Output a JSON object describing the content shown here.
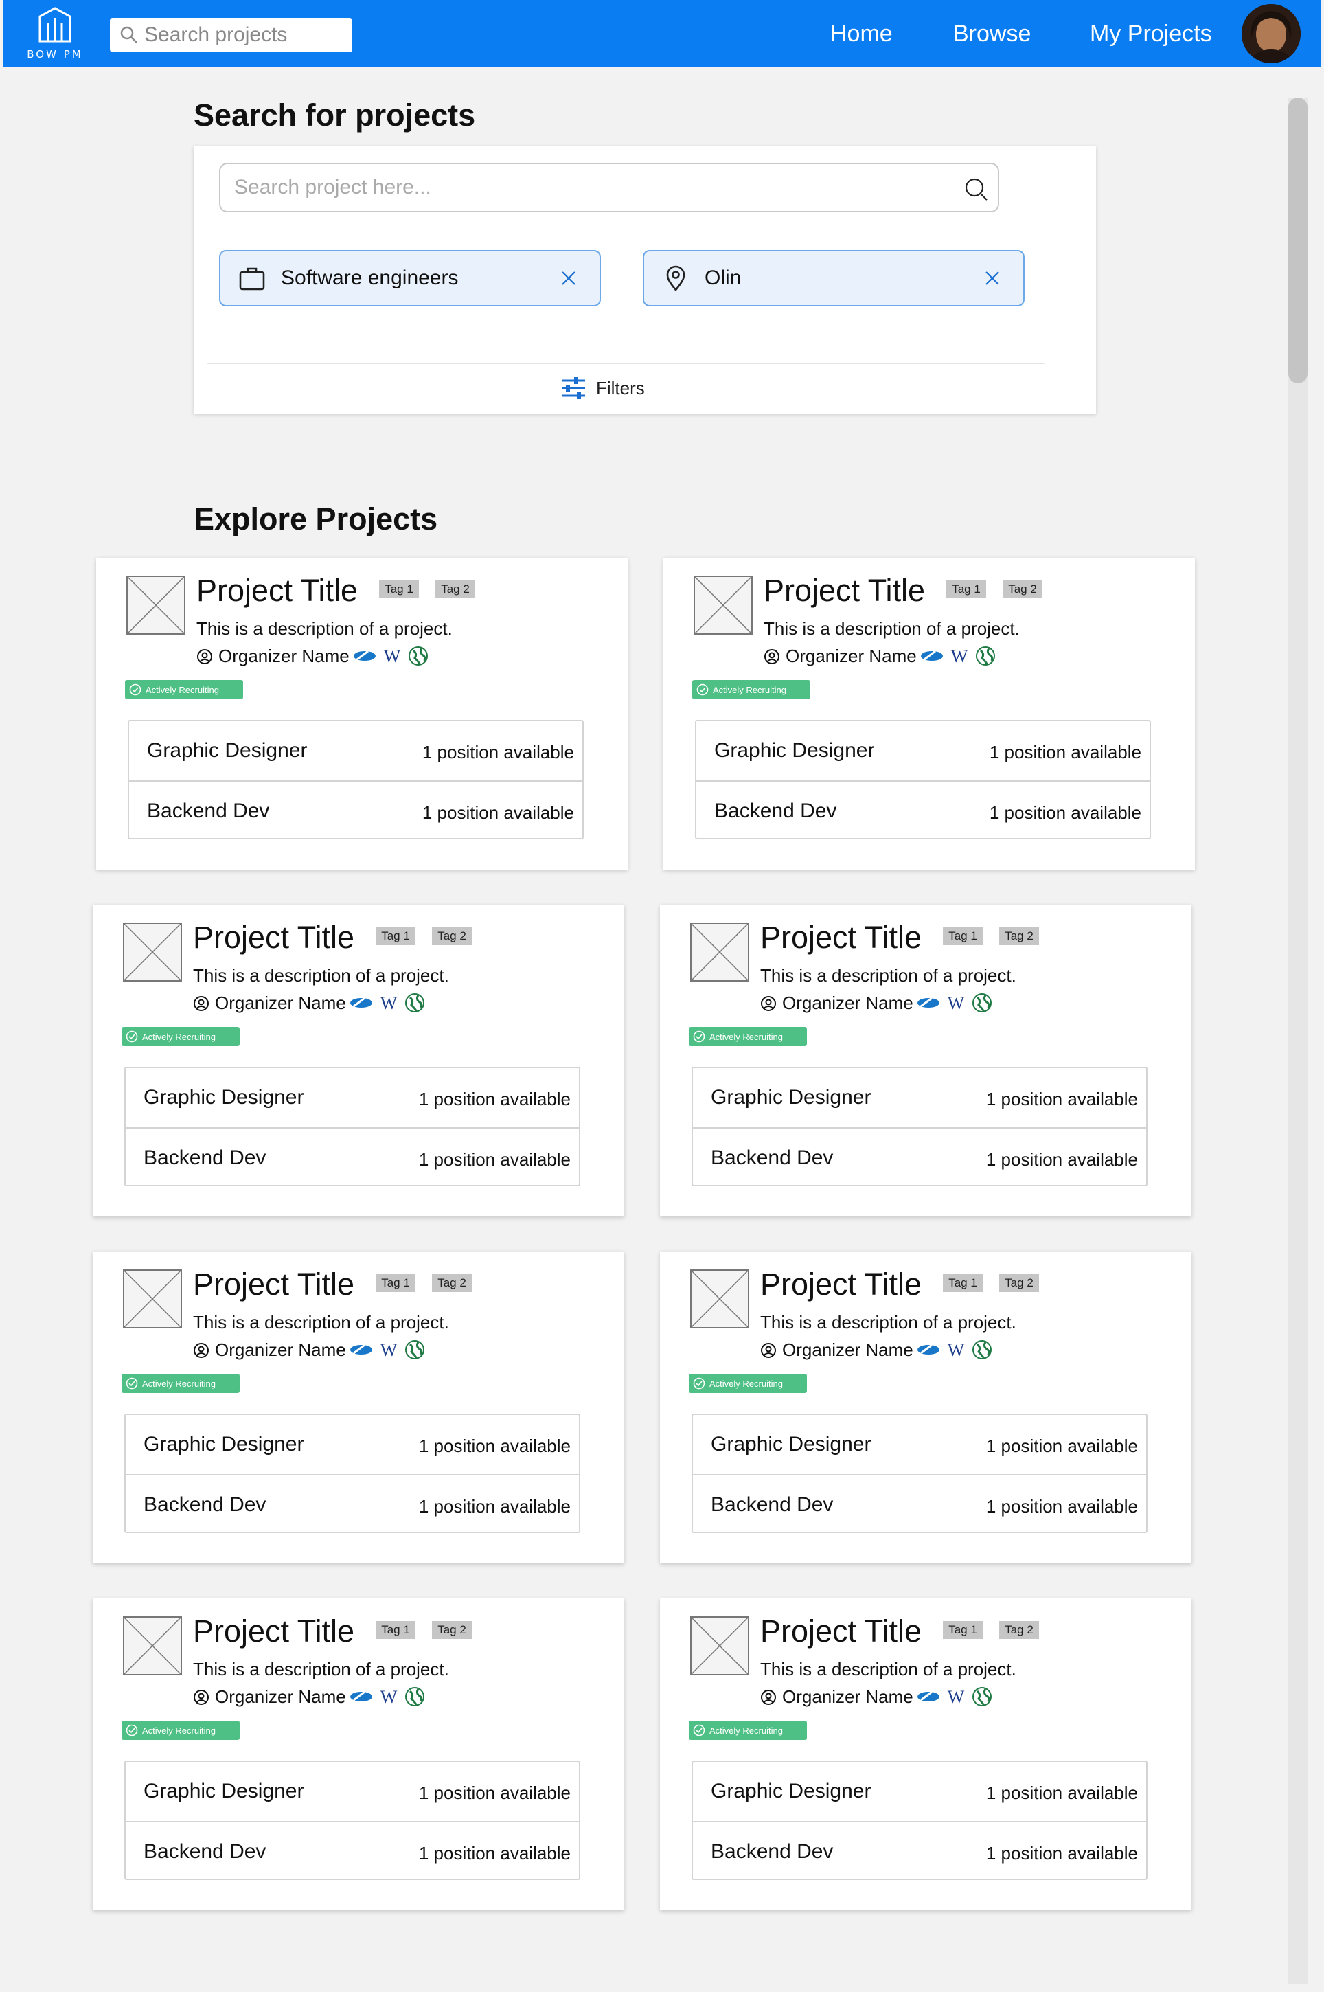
{
  "app": {
    "logo_text": "BOW PM",
    "search_placeholder": "Search projects",
    "nav": [
      "Home",
      "Browse",
      "My Projects"
    ]
  },
  "search_section": {
    "heading": "Search for projects",
    "placeholder": "Search project here...",
    "chips": [
      "Software engineers",
      "Olin"
    ],
    "filters_label": "Filters"
  },
  "explore": {
    "heading": "Explore Projects",
    "projects": [
      {
        "title": "Project Title",
        "tags": [
          "Tag 1",
          "Tag 2"
        ],
        "description": "This is a description of a project.",
        "organizer": "Organizer Name",
        "status": "Actively Recruiting",
        "positions": [
          {
            "role": "Graphic Designer",
            "availability": "1 position available"
          },
          {
            "role": "Backend Dev",
            "availability": "1 position available"
          }
        ]
      },
      {
        "title": "Project Title",
        "tags": [
          "Tag 1",
          "Tag 2"
        ],
        "description": "This is a description of a project.",
        "organizer": "Organizer Name",
        "status": "Actively Recruiting",
        "positions": [
          {
            "role": "Graphic Designer",
            "availability": "1 position available"
          },
          {
            "role": "Backend Dev",
            "availability": "1 position available"
          }
        ]
      },
      {
        "title": "Project Title",
        "tags": [
          "Tag 1",
          "Tag 2"
        ],
        "description": "This is a description of a project.",
        "organizer": "Organizer Name",
        "status": "Actively Recruiting",
        "positions": [
          {
            "role": "Graphic Designer",
            "availability": "1 position available"
          },
          {
            "role": "Backend Dev",
            "availability": "1 position available"
          }
        ]
      },
      {
        "title": "Project Title",
        "tags": [
          "Tag 1",
          "Tag 2"
        ],
        "description": "This is a description of a project.",
        "organizer": "Organizer Name",
        "status": "Actively Recruiting",
        "positions": [
          {
            "role": "Graphic Designer",
            "availability": "1 position available"
          },
          {
            "role": "Backend Dev",
            "availability": "1 position available"
          }
        ]
      },
      {
        "title": "Project Title",
        "tags": [
          "Tag 1",
          "Tag 2"
        ],
        "description": "This is a description of a project.",
        "organizer": "Organizer Name",
        "status": "Actively Recruiting",
        "positions": [
          {
            "role": "Graphic Designer",
            "availability": "1 position available"
          },
          {
            "role": "Backend Dev",
            "availability": "1 position available"
          }
        ]
      },
      {
        "title": "Project Title",
        "tags": [
          "Tag 1",
          "Tag 2"
        ],
        "description": "This is a description of a project.",
        "organizer": "Organizer Name",
        "status": "Actively Recruiting",
        "positions": [
          {
            "role": "Graphic Designer",
            "availability": "1 position available"
          },
          {
            "role": "Backend Dev",
            "availability": "1 position available"
          }
        ]
      },
      {
        "title": "Project Title",
        "tags": [
          "Tag 1",
          "Tag 2"
        ],
        "description": "This is a description of a project.",
        "organizer": "Organizer Name",
        "status": "Actively Recruiting",
        "positions": [
          {
            "role": "Graphic Designer",
            "availability": "1 position available"
          },
          {
            "role": "Backend Dev",
            "availability": "1 position available"
          }
        ]
      },
      {
        "title": "Project Title",
        "tags": [
          "Tag 1",
          "Tag 2"
        ],
        "description": "This is a description of a project.",
        "organizer": "Organizer Name",
        "status": "Actively Recruiting",
        "positions": [
          {
            "role": "Graphic Designer",
            "availability": "1 position available"
          },
          {
            "role": "Backend Dev",
            "availability": "1 position available"
          }
        ]
      }
    ]
  },
  "colors": {
    "brand_blue": "#0a7df2",
    "recruiting_green": "#4fc085",
    "chip_fill": "#e9f2fc",
    "chip_border": "#6aa8e8"
  },
  "icons": [
    "logo-icon",
    "search-icon",
    "avatar",
    "briefcase-icon",
    "location-pin-icon",
    "close-icon",
    "filters-icon",
    "image-placeholder-icon",
    "user-circle-icon",
    "link-icon",
    "wikipedia-icon",
    "globe-icon",
    "check-circle-icon"
  ]
}
